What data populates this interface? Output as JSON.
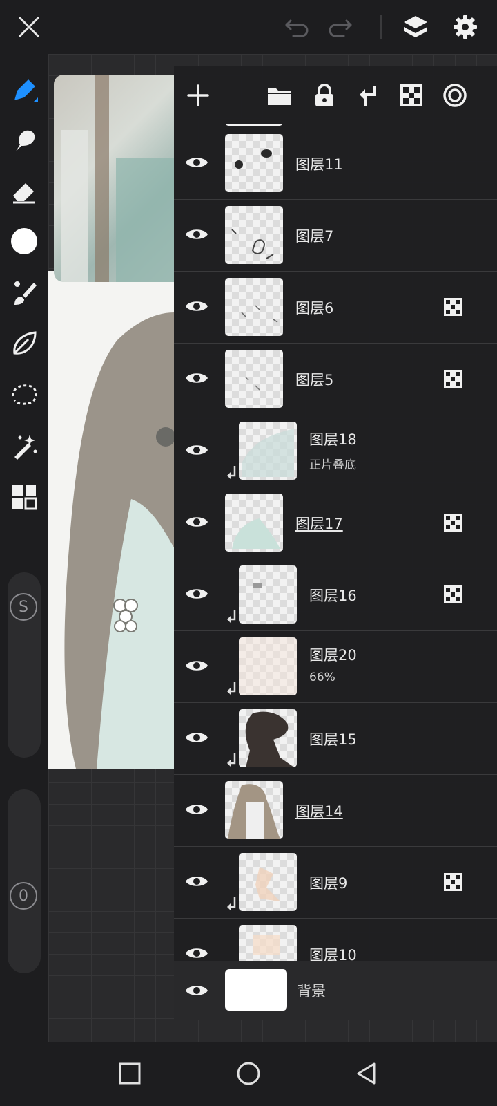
{
  "topbar": {
    "close_icon": "close-icon",
    "undo_icon": "undo-icon",
    "redo_icon": "redo-icon",
    "layers_icon": "layers-icon",
    "settings_icon": "gear-icon"
  },
  "tools": [
    "brush-icon",
    "smudge-icon",
    "eraser-icon",
    "color-swatch",
    "brush-settings-icon",
    "leaf-icon",
    "lasso-icon",
    "magic-wand-icon",
    "grid-icon"
  ],
  "colors": {
    "accent": "#1e90ff",
    "panel": "#1e1e20",
    "background": "#1d1d1f"
  },
  "sidebar": {
    "size_label": "S",
    "opacity_label": "0"
  },
  "panel_toolbar": [
    "add-layer-icon",
    "folder-icon",
    "lock-icon",
    "merge-down-icon",
    "transparency-icon",
    "target-icon"
  ],
  "layers": [
    {
      "name": "图层11",
      "sub": "",
      "clipped": false,
      "underline": false,
      "alpha_locked": false
    },
    {
      "name": "图层7",
      "sub": "",
      "clipped": false,
      "underline": false,
      "alpha_locked": false
    },
    {
      "name": "图层6",
      "sub": "",
      "clipped": false,
      "underline": false,
      "alpha_locked": true
    },
    {
      "name": "图层5",
      "sub": "",
      "clipped": false,
      "underline": false,
      "alpha_locked": true
    },
    {
      "name": "图层18",
      "sub": "正片叠底",
      "clipped": true,
      "underline": false,
      "alpha_locked": false
    },
    {
      "name": "图层17",
      "sub": "",
      "clipped": false,
      "underline": true,
      "alpha_locked": true
    },
    {
      "name": "图层16",
      "sub": "",
      "clipped": true,
      "underline": false,
      "alpha_locked": true
    },
    {
      "name": "图层20",
      "sub": "66%",
      "clipped": true,
      "underline": false,
      "alpha_locked": false
    },
    {
      "name": "图层15",
      "sub": "",
      "clipped": true,
      "underline": false,
      "alpha_locked": false
    },
    {
      "name": "图层14",
      "sub": "",
      "clipped": false,
      "underline": true,
      "alpha_locked": false
    },
    {
      "name": "图层9",
      "sub": "",
      "clipped": true,
      "underline": false,
      "alpha_locked": true
    },
    {
      "name": "图层10",
      "sub": "",
      "clipped": true,
      "underline": false,
      "alpha_locked": false
    }
  ],
  "background_layer": {
    "name": "背景"
  },
  "navbar": [
    "recent-apps-icon",
    "home-icon",
    "back-icon"
  ]
}
